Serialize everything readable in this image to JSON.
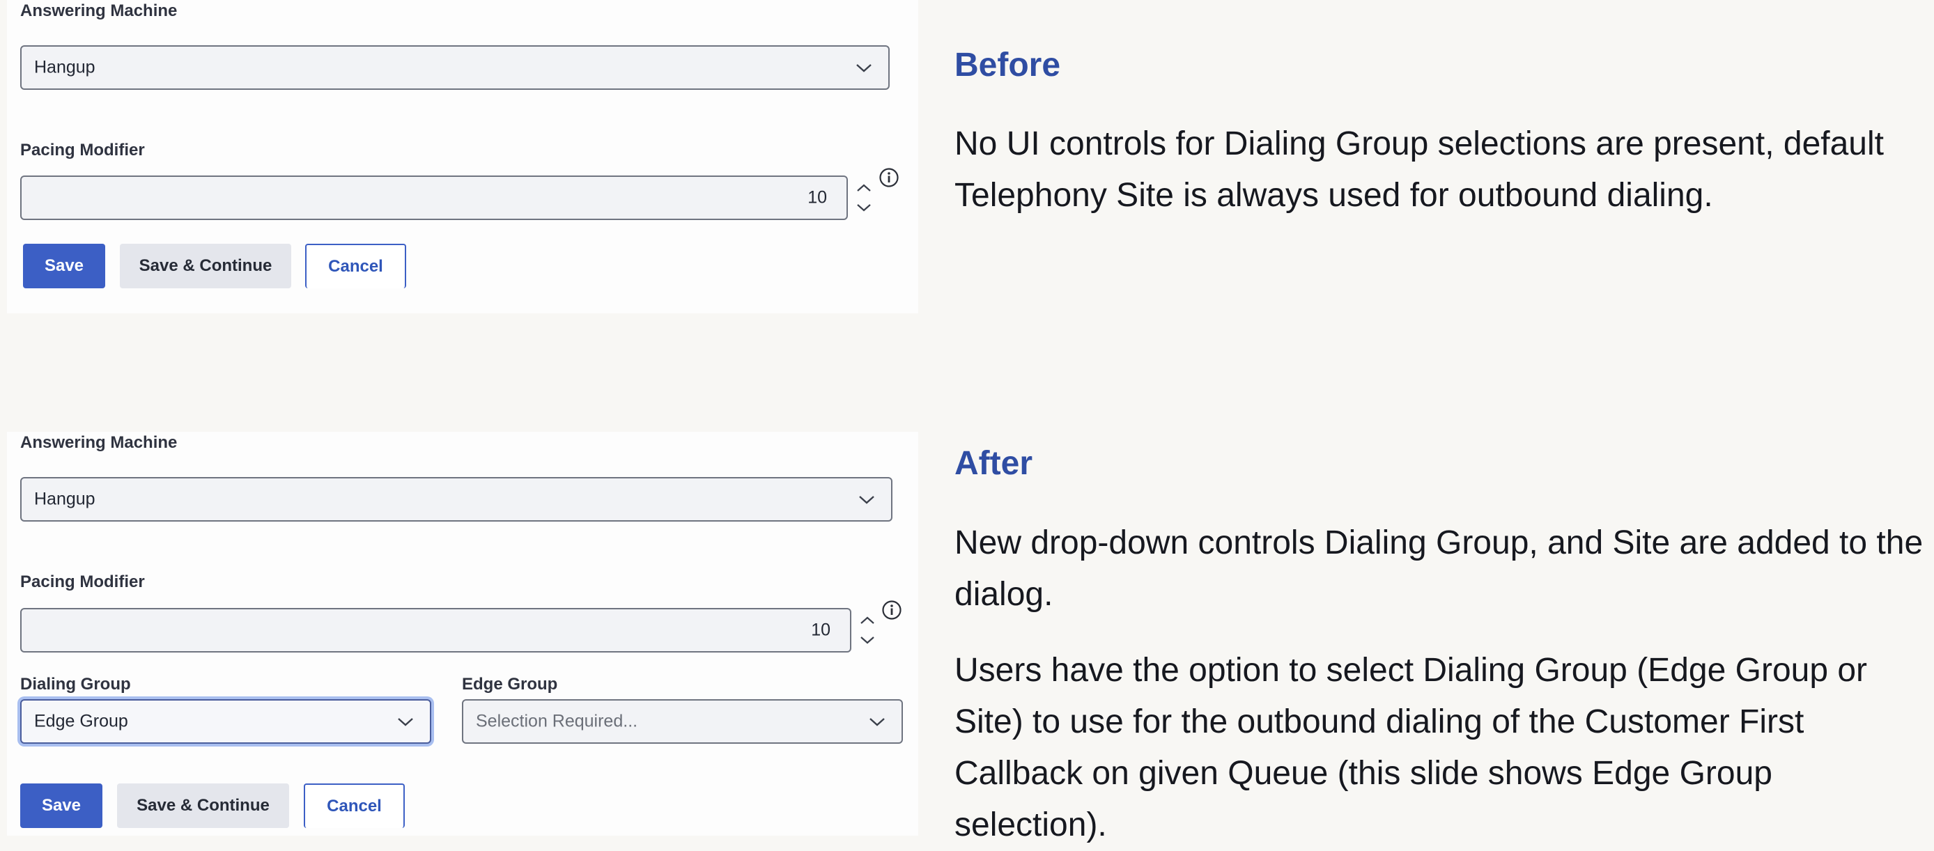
{
  "before_panel": {
    "answering_machine": {
      "label": "Answering Machine",
      "value": "Hangup"
    },
    "pacing_modifier": {
      "label": "Pacing Modifier",
      "value": "10"
    },
    "buttons": {
      "save": "Save",
      "save_continue": "Save & Continue",
      "cancel": "Cancel"
    }
  },
  "after_panel": {
    "answering_machine": {
      "label": "Answering Machine",
      "value": "Hangup"
    },
    "pacing_modifier": {
      "label": "Pacing Modifier",
      "value": "10"
    },
    "dialing_group": {
      "label": "Dialing Group",
      "value": "Edge Group"
    },
    "edge_group": {
      "label": "Edge Group",
      "placeholder": "Selection Required..."
    },
    "buttons": {
      "save": "Save",
      "save_continue": "Save & Continue",
      "cancel": "Cancel"
    }
  },
  "before_text": {
    "heading": "Before",
    "paragraph": "No UI controls for Dialing Group selections are present, default Telephony Site is always used for outbound dialing."
  },
  "after_text": {
    "heading": "After",
    "paragraph1": "New drop-down controls Dialing Group, and Site are added to the dialog.",
    "paragraph2": "Users have the option to select Dialing Group (Edge Group or Site) to use for the outbound dialing of the Customer First Callback on given Queue (this slide shows Edge Group selection)."
  },
  "icons": {
    "dropdown": "chevron-down-icon",
    "spin_up": "chevron-up-icon",
    "spin_down": "chevron-down-icon",
    "info": "info-icon"
  },
  "colors": {
    "heading": "#2f4da3",
    "primary_button": "#3c5fc5",
    "secondary_button": "#e4e6ec",
    "page_background": "#f8f7f4",
    "panel_background": "#fdfdfd",
    "focus_ring": "#a9bff0"
  }
}
